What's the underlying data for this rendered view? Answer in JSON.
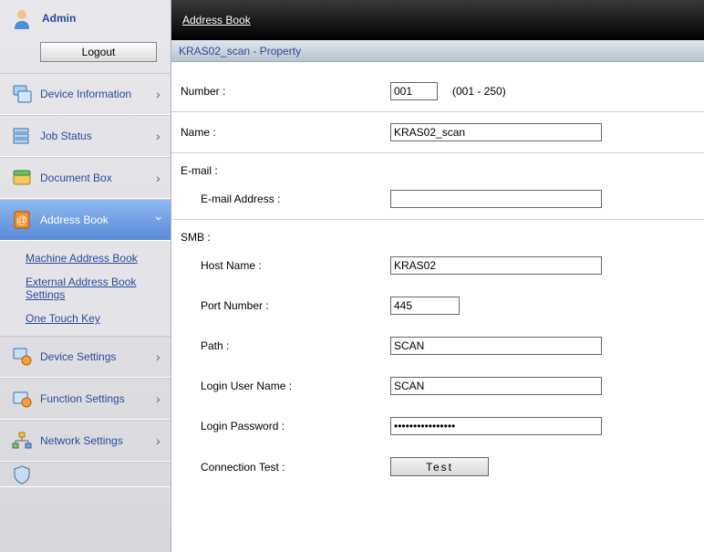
{
  "user": {
    "role": "Admin",
    "logout": "Logout"
  },
  "nav": {
    "device_info": "Device Information",
    "job_status": "Job Status",
    "doc_box": "Document Box",
    "address_book": "Address Book",
    "device_settings": "Device Settings",
    "function_settings": "Function Settings",
    "network_settings": "Network Settings",
    "sub": {
      "machine": "Machine Address Book",
      "external": "External Address Book Settings",
      "onetouch": "One Touch Key"
    }
  },
  "header": {
    "breadcrumb": "Address Book"
  },
  "panel": {
    "title": "KRAS02_scan - Property"
  },
  "form": {
    "number_label": "Number :",
    "number_value": "001",
    "number_hint": "(001  -  250)",
    "name_label": "Name :",
    "name_value": "KRAS02_scan",
    "email_section": "E-mail :",
    "email_addr_label": "E-mail Address :",
    "email_addr_value": "",
    "smb_section": "SMB :",
    "host_label": "Host Name :",
    "host_value": "KRAS02",
    "port_label": "Port Number :",
    "port_value": "445",
    "path_label": "Path :",
    "path_value": "SCAN",
    "login_user_label": "Login User Name :",
    "login_user_value": "SCAN",
    "login_pw_label": "Login Password :",
    "login_pw_value": "••••••••••••••••",
    "conn_test_label": "Connection Test :",
    "test_btn": "Test"
  }
}
